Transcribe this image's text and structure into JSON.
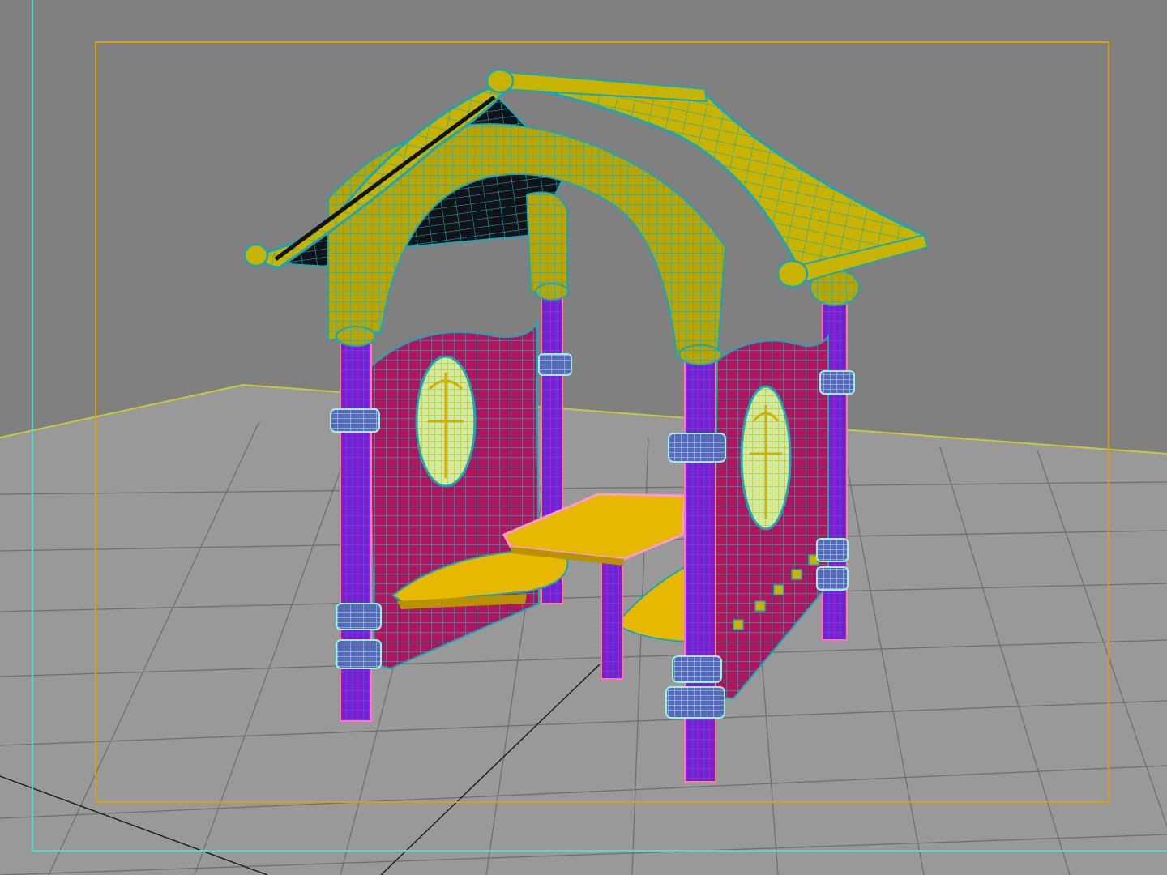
{
  "viewport": {
    "mode": "wireframe-on-shaded",
    "background_color": "#808080",
    "ground_color": "#999999",
    "grid_line_color": "#6f6f6f",
    "world_axis_color": "#1a1a1a",
    "horizon_line_color": "#c8c83a",
    "safe_frame_color": "#d4a017",
    "viewport_border_color": "#4fd8d8"
  },
  "model": {
    "name": "playhouse-gazebo",
    "parts": [
      "roof",
      "roof-ridge-log",
      "roof-eave-log",
      "arch",
      "columns",
      "side-panels",
      "portholes",
      "table",
      "benches",
      "column-clamps"
    ],
    "colors": {
      "roof": "#c8b400",
      "roof_shade": "#a89600",
      "wire": "#1aa7b5",
      "column": "#7a1fd0",
      "column_edge": "#ff7aa0",
      "panel": "#b0155e",
      "panel_wire": "#4fb0c0",
      "porthole": "#c6ecb0",
      "bench": "#e6b800",
      "table_edge": "#ff9ad0",
      "clamp": "#86e8d0"
    }
  }
}
